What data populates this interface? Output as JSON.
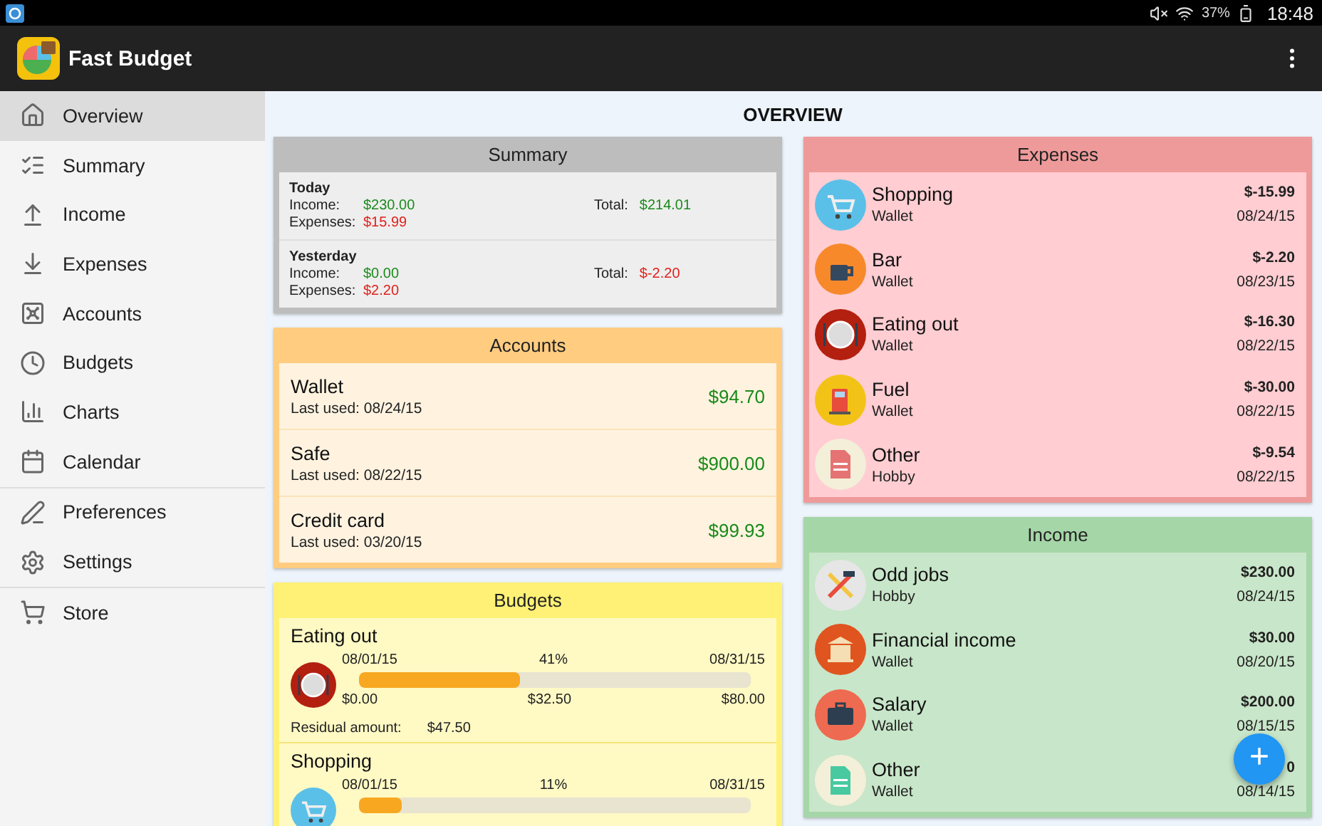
{
  "status_bar": {
    "battery": "37%",
    "time": "18:48"
  },
  "app_bar": {
    "title": "Fast Budget"
  },
  "sidebar": {
    "groups": [
      {
        "items": [
          {
            "label": "Overview",
            "kind": "home",
            "selected": true
          },
          {
            "label": "Summary",
            "kind": "list",
            "selected": false
          },
          {
            "label": "Income",
            "kind": "coinsup",
            "selected": false
          },
          {
            "label": "Expenses",
            "kind": "coinsdown",
            "selected": false
          },
          {
            "label": "Accounts",
            "kind": "safe",
            "selected": false
          },
          {
            "label": "Budgets",
            "kind": "clock",
            "selected": false
          },
          {
            "label": "Charts",
            "kind": "chart",
            "selected": false
          },
          {
            "label": "Calendar",
            "kind": "calendar",
            "selected": false
          }
        ]
      },
      {
        "items": [
          {
            "label": "Preferences",
            "kind": "pen",
            "selected": false
          },
          {
            "label": "Settings",
            "kind": "gear",
            "selected": false
          }
        ]
      },
      {
        "items": [
          {
            "label": "Store",
            "kind": "cart",
            "selected": false
          }
        ]
      }
    ]
  },
  "page_title": "OVERVIEW",
  "summary": {
    "title": "Summary",
    "periods": [
      {
        "label": "Today",
        "income_label": "Income:",
        "income": "$230.00",
        "expenses_label": "Expenses:",
        "expenses": "$15.99",
        "total_label": "Total:",
        "total": "$214.01",
        "negative": false
      },
      {
        "label": "Yesterday",
        "income_label": "Income:",
        "income": "$0.00",
        "expenses_label": "Expenses:",
        "expenses": "$2.20",
        "total_label": "Total:",
        "total": "$-2.20",
        "negative": true
      }
    ]
  },
  "accounts": {
    "title": "Accounts",
    "rows": [
      {
        "name": "Wallet",
        "last_used": "Last used: 08/24/15",
        "amount": "$94.70"
      },
      {
        "name": "Safe",
        "last_used": "Last used: 08/22/15",
        "amount": "$900.00"
      },
      {
        "name": "Credit card",
        "last_used": "Last used: 03/20/15",
        "amount": "$99.93"
      }
    ]
  },
  "budgets": {
    "title": "Budgets",
    "rows": [
      {
        "name": "Eating out",
        "kind": "plate",
        "start": "08/01/15",
        "percent": "41%",
        "end": "08/31/15",
        "level": 0.41,
        "min": "$0.00",
        "spent": "$32.50",
        "max": "$80.00",
        "residual_label": "Residual amount:",
        "residual": "$47.50"
      },
      {
        "name": "Shopping",
        "kind": "cart",
        "start": "08/01/15",
        "percent": "11%",
        "end": "08/31/15",
        "level": 0.11
      }
    ]
  },
  "expenses": {
    "title": "Expenses",
    "rows": [
      {
        "name": "Shopping",
        "account": "Wallet",
        "amount": "$-15.99",
        "date": "08/24/15",
        "kind": "cart"
      },
      {
        "name": "Bar",
        "account": "Wallet",
        "amount": "$-2.20",
        "date": "08/23/15",
        "kind": "cup"
      },
      {
        "name": "Eating out",
        "account": "Wallet",
        "amount": "$-16.30",
        "date": "08/22/15",
        "kind": "plate"
      },
      {
        "name": "Fuel",
        "account": "Wallet",
        "amount": "$-30.00",
        "date": "08/22/15",
        "kind": "fuel"
      },
      {
        "name": "Other",
        "account": "Hobby",
        "amount": "$-9.54",
        "date": "08/22/15",
        "kind": "docred"
      }
    ]
  },
  "income": {
    "title": "Income",
    "rows": [
      {
        "name": "Odd jobs",
        "account": "Hobby",
        "amount": "$230.00",
        "date": "08/24/15",
        "kind": "tools"
      },
      {
        "name": "Financial income",
        "account": "Wallet",
        "amount": "$30.00",
        "date": "08/20/15",
        "kind": "bank"
      },
      {
        "name": "Salary",
        "account": "Wallet",
        "amount": "$200.00",
        "date": "08/15/15",
        "kind": "briefcase"
      },
      {
        "name": "Other",
        "account": "Wallet",
        "amount": "0",
        "date": "08/14/15",
        "kind": "docgreen"
      }
    ]
  },
  "fab": {
    "label": "+"
  }
}
